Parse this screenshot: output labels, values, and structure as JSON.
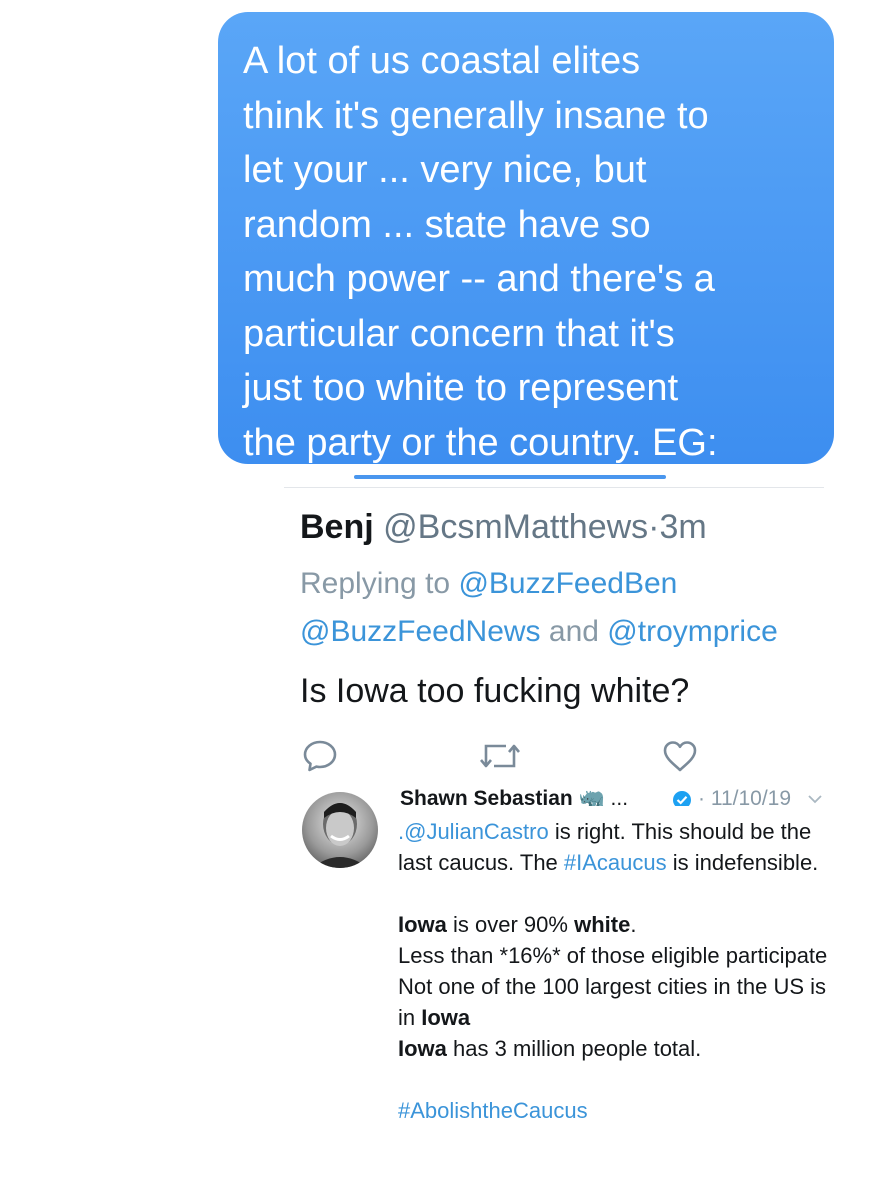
{
  "message_bubble": {
    "text": "A lot of us coastal elites\nthink it's generally insane to\nlet your ... very nice, but\nrandom ... state have so\nmuch power -- and there's a\nparticular concern that it's\njust too white to represent\nthe party or the country. EG:",
    "color": "#4a96ee"
  },
  "tweet1": {
    "name": "Benj",
    "handle": "@BcsmMatthews",
    "separator": "·",
    "time": "3m",
    "replying_to_label": "Replying to",
    "reply_mentions_1": "@BuzzFeedBen",
    "reply_mentions_2": "@BuzzFeedNews",
    "and_label": "and",
    "reply_mentions_3": "@troymprice",
    "body": "Is Iowa too fucking white?",
    "actions": [
      "reply-icon",
      "retweet-icon",
      "like-icon"
    ]
  },
  "tweet2": {
    "name": "Shawn Sebastian",
    "name_suffix": "🦏 ...",
    "date": "· 11/10/19",
    "mention": ".@JulianCastro",
    "line1_rest": " is right. This should be the last caucus. The ",
    "hashtag1": "#IAcaucus",
    "line1_end": " is indefensible.",
    "iowa": "Iowa",
    "white": "white",
    "l2_mid": " is over 90% ",
    "l2_end": ".",
    "l3": "Less than *16%* of those eligible participate",
    "l4_start": "Not one of the 100 largest cities in the US is in ",
    "l5_rest": " has 3 million people total.",
    "hashtag2": "#AbolishtheCaucus"
  }
}
